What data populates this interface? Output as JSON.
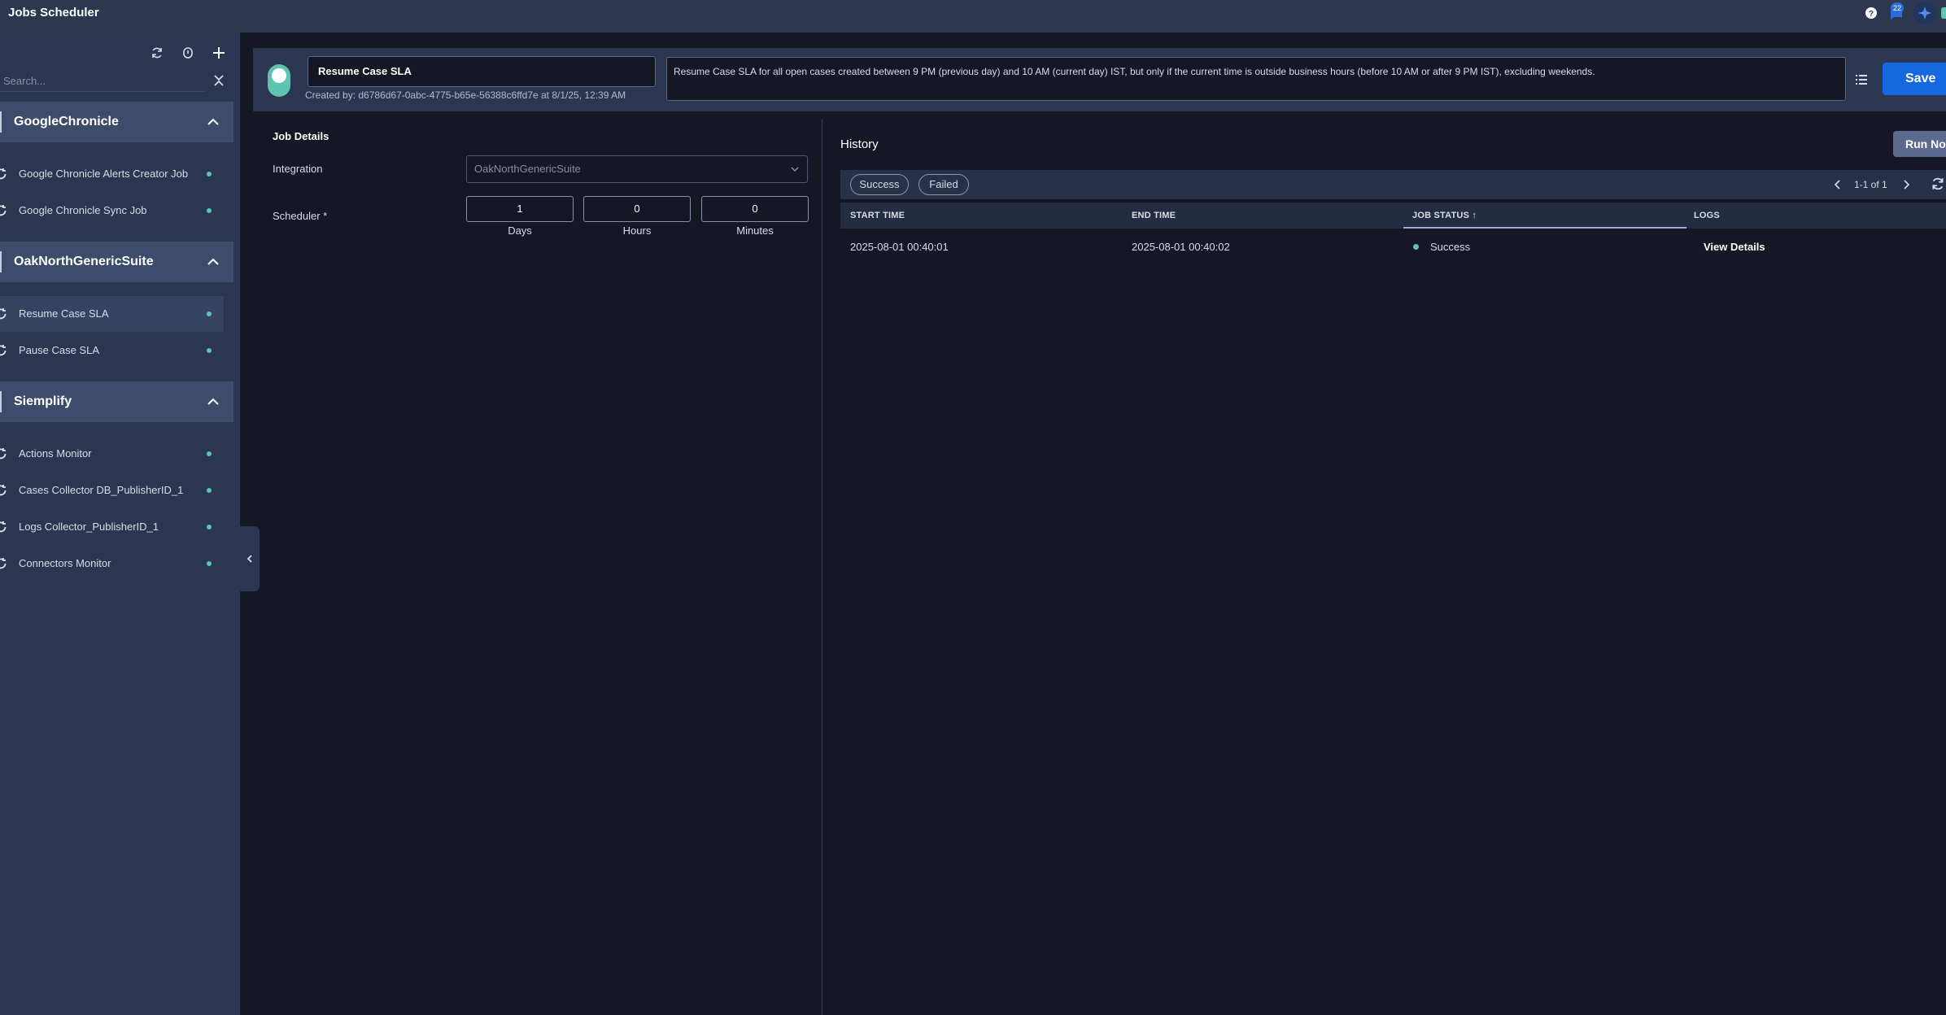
{
  "app": {
    "title": "Jobs Scheduler",
    "notification_count": "22"
  },
  "sidebar": {
    "search_placeholder": "Search...",
    "groups": [
      {
        "name": "GoogleChronicle",
        "items": [
          {
            "label": "Google Chronicle Alerts Creator Job"
          },
          {
            "label": "Google Chronicle Sync Job"
          }
        ]
      },
      {
        "name": "OakNorthGenericSuite",
        "items": [
          {
            "label": "Resume Case SLA",
            "active": true
          },
          {
            "label": "Pause Case SLA"
          }
        ]
      },
      {
        "name": "Siemplify",
        "items": [
          {
            "label": "Actions Monitor"
          },
          {
            "label": "Cases Collector DB_PublisherID_1"
          },
          {
            "label": "Logs Collector_PublisherID_1"
          },
          {
            "label": "Connectors Monitor"
          }
        ]
      }
    ]
  },
  "job": {
    "enabled": true,
    "name": "Resume Case SLA",
    "created_by": "Created by: d6786d67-0abc-4775-b65e-56388c6ffd7e at 8/1/25, 12:39 AM",
    "description": "Resume Case SLA for all open cases created between 9 PM (previous day) and 10 AM (current day) IST, but only if the current time is outside business hours (before 10 AM or after 9 PM IST), excluding weekends.",
    "save_label": "Save"
  },
  "details": {
    "title": "Job Details",
    "integration_label": "Integration",
    "integration_value": "OakNorthGenericSuite",
    "scheduler_label": "Scheduler *",
    "days_value": "1",
    "days_label": "Days",
    "hours_value": "0",
    "hours_label": "Hours",
    "minutes_value": "0",
    "minutes_label": "Minutes"
  },
  "history": {
    "title": "History",
    "run_now_label": "Run Now",
    "filters": [
      "Success",
      "Failed"
    ],
    "pager": "1-1 of 1",
    "columns": [
      "START TIME",
      "END TIME",
      "JOB STATUS",
      "LOGS"
    ],
    "sort_indicator": "↑",
    "rows": [
      {
        "start": "2025-08-01 00:40:01",
        "end": "2025-08-01 00:40:02",
        "status": "Success",
        "logs": "View Details"
      }
    ]
  },
  "colors": {
    "accent": "#1767e0",
    "status_ok": "#5ec4b0",
    "sidebar_bg": "#2b3650",
    "main_bg": "#161725"
  }
}
